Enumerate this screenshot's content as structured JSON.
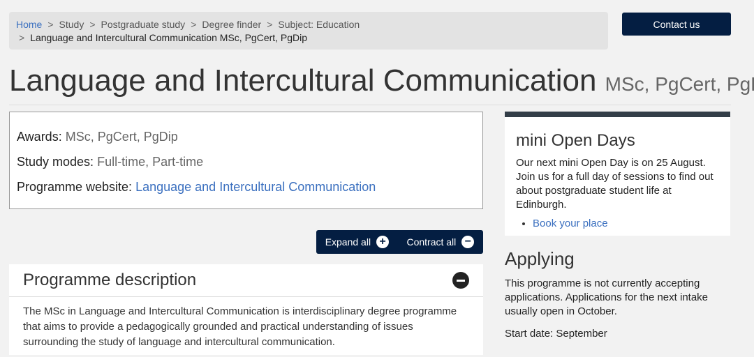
{
  "breadcrumb": {
    "items": [
      "Home",
      "Study",
      "Postgraduate study",
      "Degree finder",
      "Subject: Education"
    ],
    "current": "Language and Intercultural Communication MSc, PgCert, PgDip"
  },
  "header": {
    "contact_label": "Contact us"
  },
  "title": {
    "main": "Language and Intercultural Communication",
    "awards": "MSc, PgCert, PgDip"
  },
  "info": {
    "awards_label": "Awards:",
    "awards_value": "MSc, PgCert, PgDip",
    "modes_label": "Study modes:",
    "modes_value": "Full-time, Part-time",
    "website_label": "Programme website:",
    "website_link": "Language and Intercultural Communication"
  },
  "controls": {
    "expand_label": "Expand all",
    "contract_label": "Contract all"
  },
  "description": {
    "heading": "Programme description",
    "text": "The MSc in Language and Intercultural Communication is interdisciplinary degree programme that aims to provide a pedagogically grounded and practical understanding of issues surrounding the study of language and intercultural communication."
  },
  "open_days": {
    "heading": "mini Open Days",
    "text": "Our next mini Open Day is on 25 August. Join us for a full day of sessions to find out about postgraduate student life at Edinburgh.",
    "link": "Book your place"
  },
  "applying": {
    "heading": "Applying",
    "text": "This programme is not currently accepting applications. Applications for the next intake usually open in October.",
    "start_date": "Start date: September"
  }
}
